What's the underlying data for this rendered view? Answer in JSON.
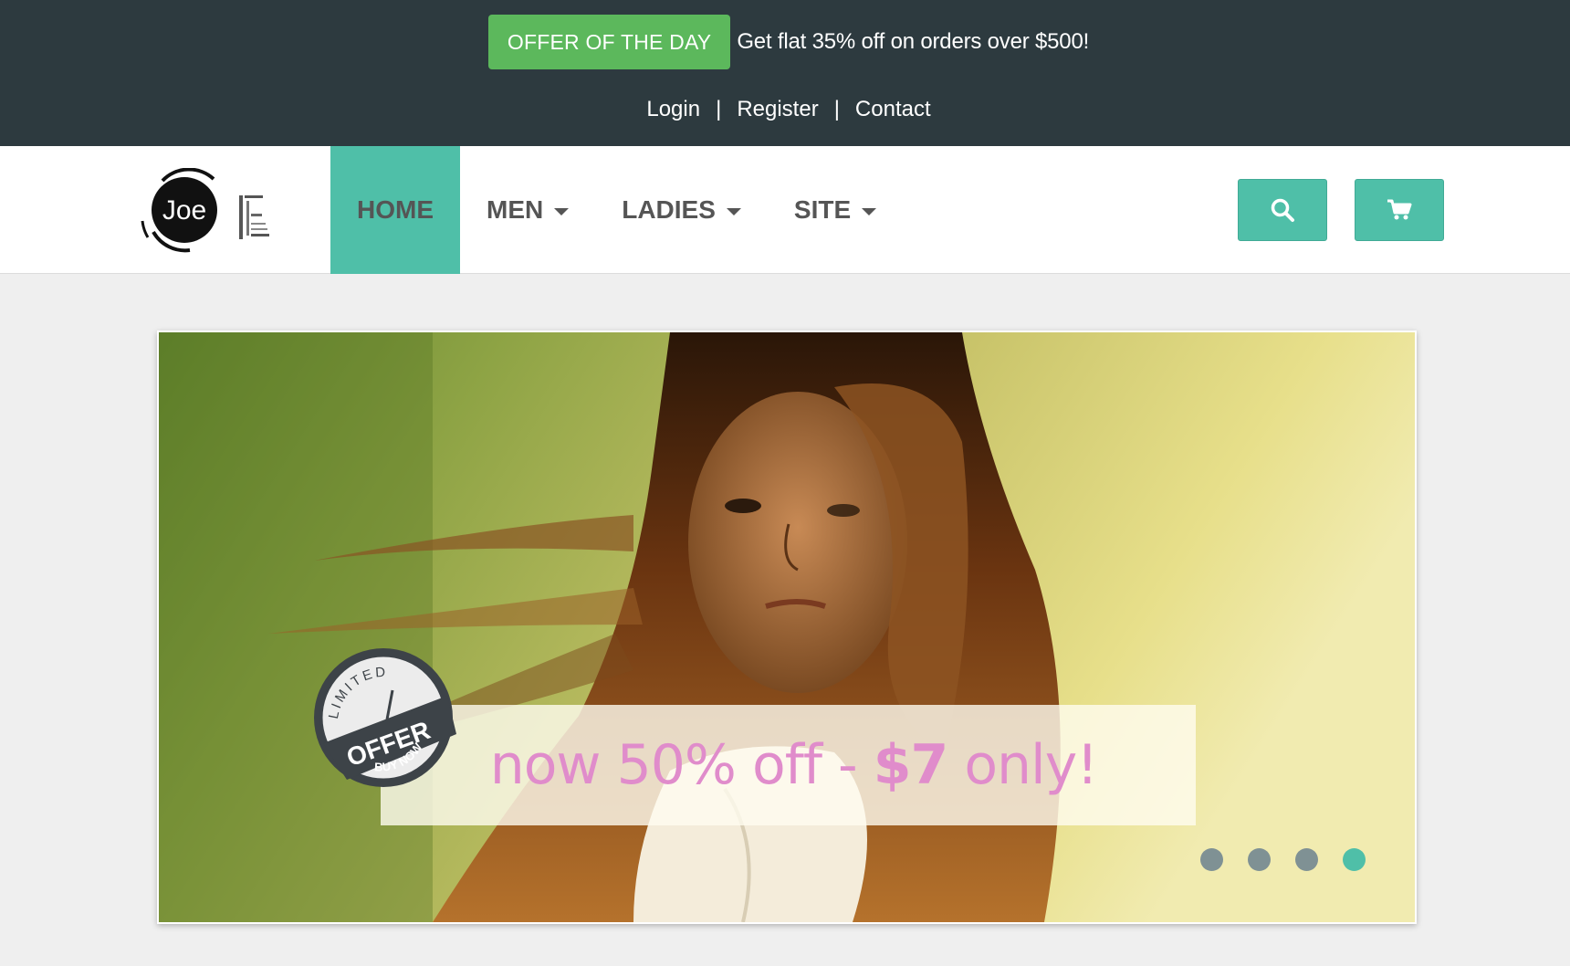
{
  "topbar": {
    "offer_badge": "OFFER OF THE DAY",
    "offer_text": "Get flat 35% off on orders over $500!",
    "links": {
      "login": "Login",
      "register": "Register",
      "contact": "Contact",
      "separator": "|"
    }
  },
  "navbar": {
    "logo_text": "Joe",
    "items": [
      {
        "label": "HOME",
        "active": true,
        "dropdown": false
      },
      {
        "label": "MEN",
        "active": false,
        "dropdown": true
      },
      {
        "label": "LADIES",
        "active": false,
        "dropdown": true
      },
      {
        "label": "SITE",
        "active": false,
        "dropdown": true
      }
    ],
    "buttons": [
      {
        "icon": "search-icon"
      },
      {
        "icon": "cart-icon"
      }
    ]
  },
  "hero": {
    "caption_prefix": "now 50% off - ",
    "caption_price": "$7",
    "caption_suffix": " only!",
    "seal": {
      "top_text": "LIMITED",
      "main_text": "OFFER",
      "bottom_text": "BUY NOW"
    },
    "dots_count": 4,
    "active_dot": 4
  },
  "colors": {
    "topbar_bg": "#2d3a3f",
    "offer_green": "#5cb85c",
    "accent_teal": "#4fbfa8",
    "caption_pink": "#e08ccb",
    "dot_gray": "#7f9194"
  }
}
